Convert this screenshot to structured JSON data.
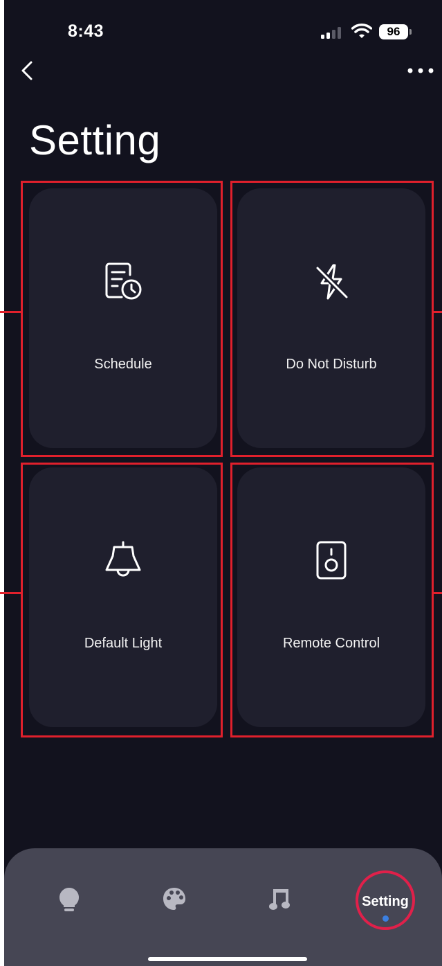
{
  "status_bar": {
    "time": "8:43",
    "battery": "96"
  },
  "page": {
    "title": "Setting"
  },
  "tiles": [
    {
      "label": "Schedule",
      "icon": "schedule-icon"
    },
    {
      "label": "Do Not Disturb",
      "icon": "flash-off-icon"
    },
    {
      "label": "Default Light",
      "icon": "bell-icon"
    },
    {
      "label": "Remote Control",
      "icon": "remote-icon"
    }
  ],
  "tab_bar": {
    "items": [
      {
        "icon": "bulb-icon"
      },
      {
        "icon": "palette-icon"
      },
      {
        "icon": "music-note-icon"
      },
      {
        "label": "Setting",
        "active": true
      }
    ]
  },
  "colors": {
    "background": "#12121e",
    "tile": "#1f1f2d",
    "tab_bar": "#464654",
    "highlight": "#e0202c",
    "active_dot": "#3b7fe0"
  }
}
